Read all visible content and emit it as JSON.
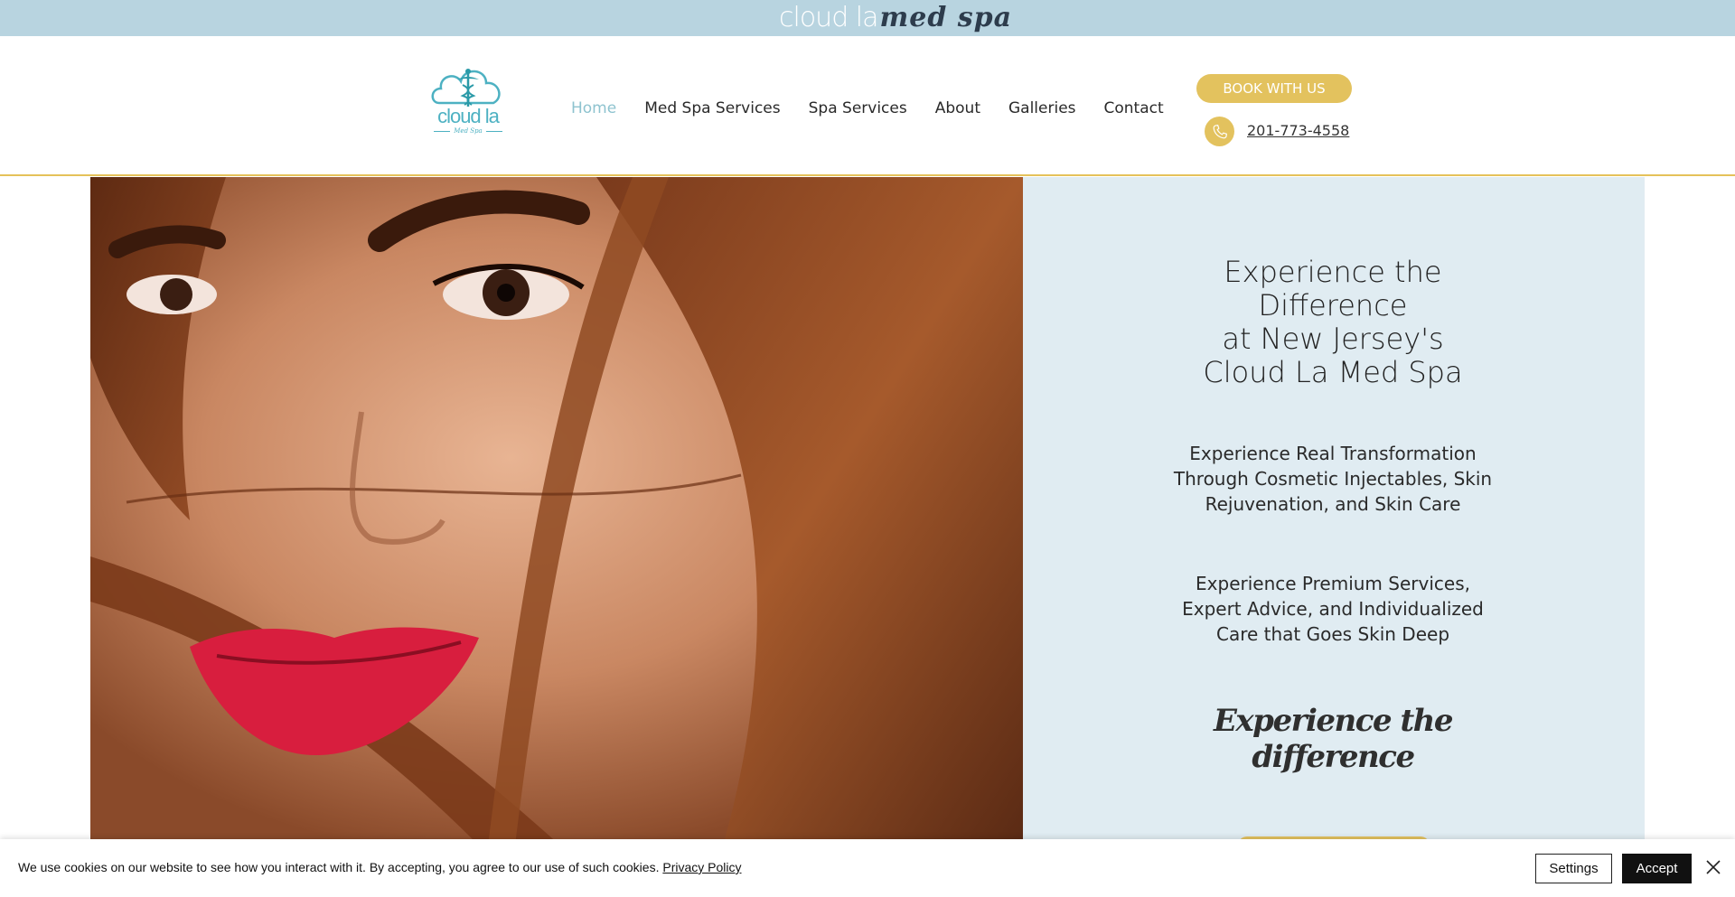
{
  "top_banner": {
    "brand_light": "cloud la",
    "brand_script": "med spa"
  },
  "header": {
    "logo": {
      "text": "cloud la",
      "subtext": "Med Spa",
      "icon": "caduceus-cloud-icon"
    },
    "nav": [
      {
        "label": "Home",
        "active": true
      },
      {
        "label": "Med Spa Services",
        "active": false
      },
      {
        "label": "Spa Services",
        "active": false
      },
      {
        "label": "About",
        "active": false
      },
      {
        "label": "Galleries",
        "active": false
      },
      {
        "label": "Contact",
        "active": false
      }
    ],
    "book_label": "BOOK WITH US",
    "phone": "201-773-4558",
    "phone_icon": "phone-icon"
  },
  "hero": {
    "image": "woman-portrait-photo",
    "title_lines": [
      "Experience the",
      "Difference",
      "at New Jersey's",
      "Cloud La Med Spa"
    ],
    "paragraph1_lines": [
      "Experience Real Transformation",
      "Through Cosmetic Injectables, Skin",
      "Rejuvenation, and Skin Care"
    ],
    "paragraph2_lines": [
      "Experience Premium Services,",
      "Expert Advice, and Individualized",
      "Care that Goes Skin Deep"
    ],
    "script": "Experience the difference"
  },
  "cookie": {
    "text": "We use cookies on our website to see how you interact with it. By accepting, you agree to our use of such cookies.",
    "policy_link": "Privacy Policy",
    "settings_label": "Settings",
    "accept_label": "Accept",
    "close_icon": "close-icon"
  },
  "colors": {
    "banner": "#b8d4e0",
    "accent_gold": "#e3c25e",
    "nav_active": "#8ec3cf",
    "panel": "#e0ecf2",
    "logo_teal": "#4db1c2"
  }
}
